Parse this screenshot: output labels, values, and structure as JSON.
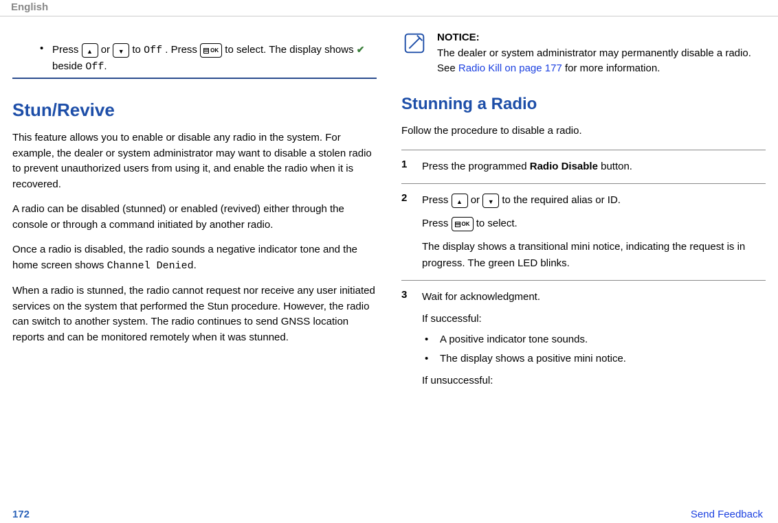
{
  "header": {
    "lang": "English"
  },
  "left": {
    "bullet": {
      "press": "Press ",
      "or": " or ",
      "to_off": " to ",
      "off": "Off",
      "press2": ". Press ",
      "to_select": " to select. The display shows ",
      "beside": " beside ",
      "off2": "Off",
      "dot": "."
    },
    "h1": "Stun/Revive",
    "p1": "This feature allows you to enable or disable any radio in the system. For example, the dealer or system administrator may want to disable a stolen radio to prevent unauthorized users from using it, and enable the radio when it is recovered.",
    "p2": "A radio can be disabled (stunned) or enabled (revived) either through the console or through a command initiated by another radio.",
    "p3_a": "Once a radio is disabled, the radio sounds a negative indicator tone and the home screen shows ",
    "p3_mono": "Channel Denied",
    "p3_b": ".",
    "p4": "When a radio is stunned, the radio cannot request nor receive any user initiated services on the system that performed the Stun procedure. However, the radio can switch to another system. The radio continues to send GNSS location reports and can be monitored remotely when it was stunned."
  },
  "right": {
    "notice": {
      "title": "NOTICE:",
      "body_a": "The dealer or system administrator may permanently disable a radio. See ",
      "link": "Radio Kill on page 177",
      "body_b": " for more information."
    },
    "h2": "Stunning a Radio",
    "intro": "Follow the procedure to disable a radio.",
    "steps": {
      "s1": {
        "num": "1",
        "text_a": "Press the programmed ",
        "bold": "Radio Disable",
        "text_b": " button."
      },
      "s2": {
        "num": "2",
        "line1_a": "Press ",
        "line1_or": " or ",
        "line1_b": " to the required alias or ID.",
        "line2_a": "Press ",
        "line2_b": " to select.",
        "line3": "The display shows a transitional mini notice, indicating the request is in progress. The green LED blinks."
      },
      "s3": {
        "num": "3",
        "wait": "Wait for acknowledgment.",
        "succ": "If successful:",
        "b1": "A positive indicator tone sounds.",
        "b2": "The display shows a positive mini notice.",
        "unsucc": "If unsuccessful:"
      }
    }
  },
  "footer": {
    "page": "172",
    "feedback": "Send Feedback"
  }
}
